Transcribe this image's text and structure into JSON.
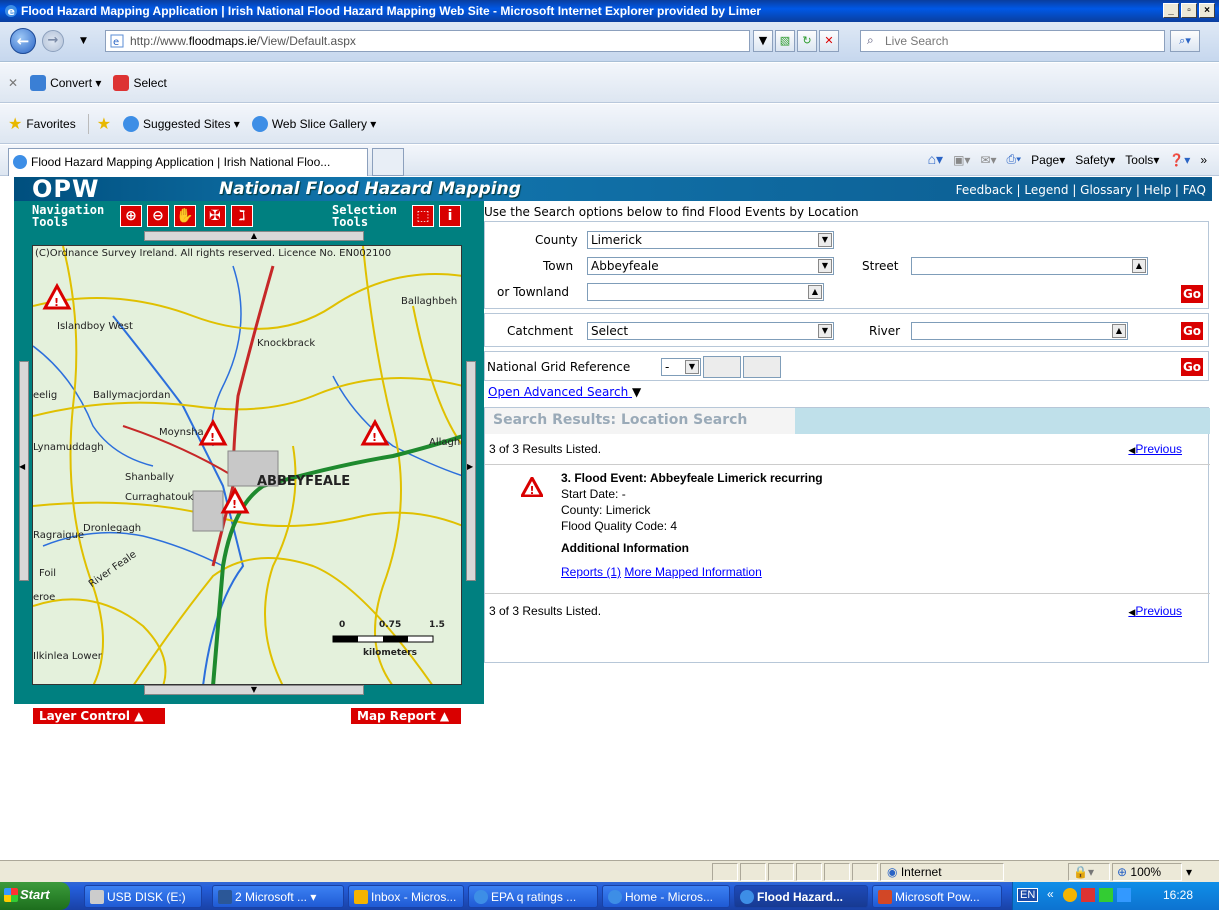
{
  "window": {
    "title": "Flood Hazard Mapping Application | Irish National Flood Hazard Mapping Web Site - Microsoft Internet Explorer provided by Limer"
  },
  "browser": {
    "address": "http://www.floodmaps.ie/View/Default.aspx",
    "address_prefix": "http://www.",
    "address_domain": "floodmaps.ie",
    "address_suffix": "/View/Default.aspx",
    "search_placeholder": "Live Search",
    "convert_label": "Convert",
    "select_label": "Select",
    "favorites_label": "Favorites",
    "suggested_sites": "Suggested Sites",
    "web_slice": "Web Slice Gallery",
    "tab_title": "Flood Hazard Mapping Application | Irish National Floo...",
    "cmd_page": "Page",
    "cmd_safety": "Safety",
    "cmd_tools": "Tools"
  },
  "site": {
    "logo": "OPW",
    "title": "National Flood Hazard Mapping",
    "links": [
      "Feedback",
      "Legend",
      "Glossary",
      "Help",
      "FAQ"
    ]
  },
  "map": {
    "nav_tools_label": "Navigation Tools",
    "nav_line1": "Navigation",
    "nav_line2": "Tools",
    "sel_line1": "Selection",
    "sel_line2": "Tools",
    "copyright": "(C)Ordnance Survey Ireland. All rights reserved. Licence No. EN002100",
    "places": [
      "Ballaghbeh",
      "Islandboy West",
      "Knockbrack",
      "Ballymacjordan",
      "Moynsha",
      "Lynamuddagh",
      "Allagh",
      "Shanbally",
      "Curraghatouk",
      "ABBEYFEALE",
      "Dronlegagh",
      "Ragraigue",
      "Foil",
      "River Feale",
      "eroe",
      "Ilkinlea Lower",
      "eelig"
    ],
    "scale_labels": [
      "0",
      "0.75",
      "1.5"
    ],
    "scale_unit": "kilometers",
    "layer_control": "Layer Control",
    "map_report": "Map Report"
  },
  "search": {
    "intro": "Use the Search options below to find Flood Events by Location",
    "county_label": "County",
    "county_value": "Limerick",
    "town_label": "Town",
    "town_value": "Abbeyfeale",
    "street_label": "Street",
    "street_value": "",
    "townland_label": "or Townland",
    "townland_value": "",
    "catchment_label": "Catchment",
    "catchment_value": "Select",
    "river_label": "River",
    "river_value": "",
    "ngr_label": "National Grid Reference",
    "ngr_value": "-",
    "go": "Go",
    "advanced": "Open Advanced Search"
  },
  "results": {
    "header": "Search Results: Location Search",
    "count_text": "3 of 3 Results Listed.",
    "previous": "Previous",
    "item": {
      "title": "3. Flood Event: Abbeyfeale Limerick recurring",
      "start_date": "Start Date: -",
      "county": "County: Limerick",
      "quality": "Flood Quality Code: 4",
      "additional": "Additional Information",
      "reports": "Reports (1)",
      "mapped": "More Mapped Information"
    }
  },
  "status": {
    "zone": "Internet",
    "zoom": "100%"
  },
  "taskbar": {
    "start": "Start",
    "tasks": [
      "USB DISK (E:)",
      "2 Microsoft ...",
      "Inbox - Micros...",
      "EPA q ratings ...",
      "Home - Micros...",
      "Flood Hazard...",
      "Microsoft Pow..."
    ],
    "lang": "EN",
    "clock": "16:28"
  },
  "colors": {
    "accent_red": "#d90000",
    "teal": "#008080",
    "link": "#0000ff"
  }
}
